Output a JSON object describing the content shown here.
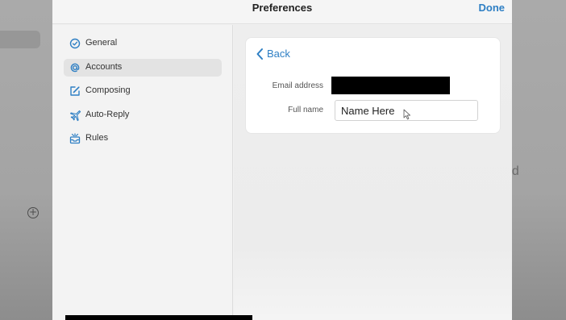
{
  "background": {
    "partial_text": "ed",
    "plus_icon": "plus-circle-icon"
  },
  "header": {
    "title": "Preferences",
    "done_label": "Done"
  },
  "sidebar": {
    "items": [
      {
        "label": "General",
        "icon": "checkmark-circle-icon",
        "active": false
      },
      {
        "label": "Accounts",
        "icon": "at-sign-icon",
        "active": true
      },
      {
        "label": "Composing",
        "icon": "compose-icon",
        "active": false
      },
      {
        "label": "Auto-Reply",
        "icon": "airplane-icon",
        "active": false
      },
      {
        "label": "Rules",
        "icon": "rules-inbox-icon",
        "active": false
      }
    ]
  },
  "account": {
    "back_label": "Back",
    "email_label": "Email address",
    "email_value_redacted": true,
    "fullname_label": "Full name",
    "fullname_value": "Name Here"
  },
  "colors": {
    "accent": "#2e7fc4",
    "sheet_bg": "#f1f1f1",
    "active_item_bg": "#e3e3e3"
  }
}
